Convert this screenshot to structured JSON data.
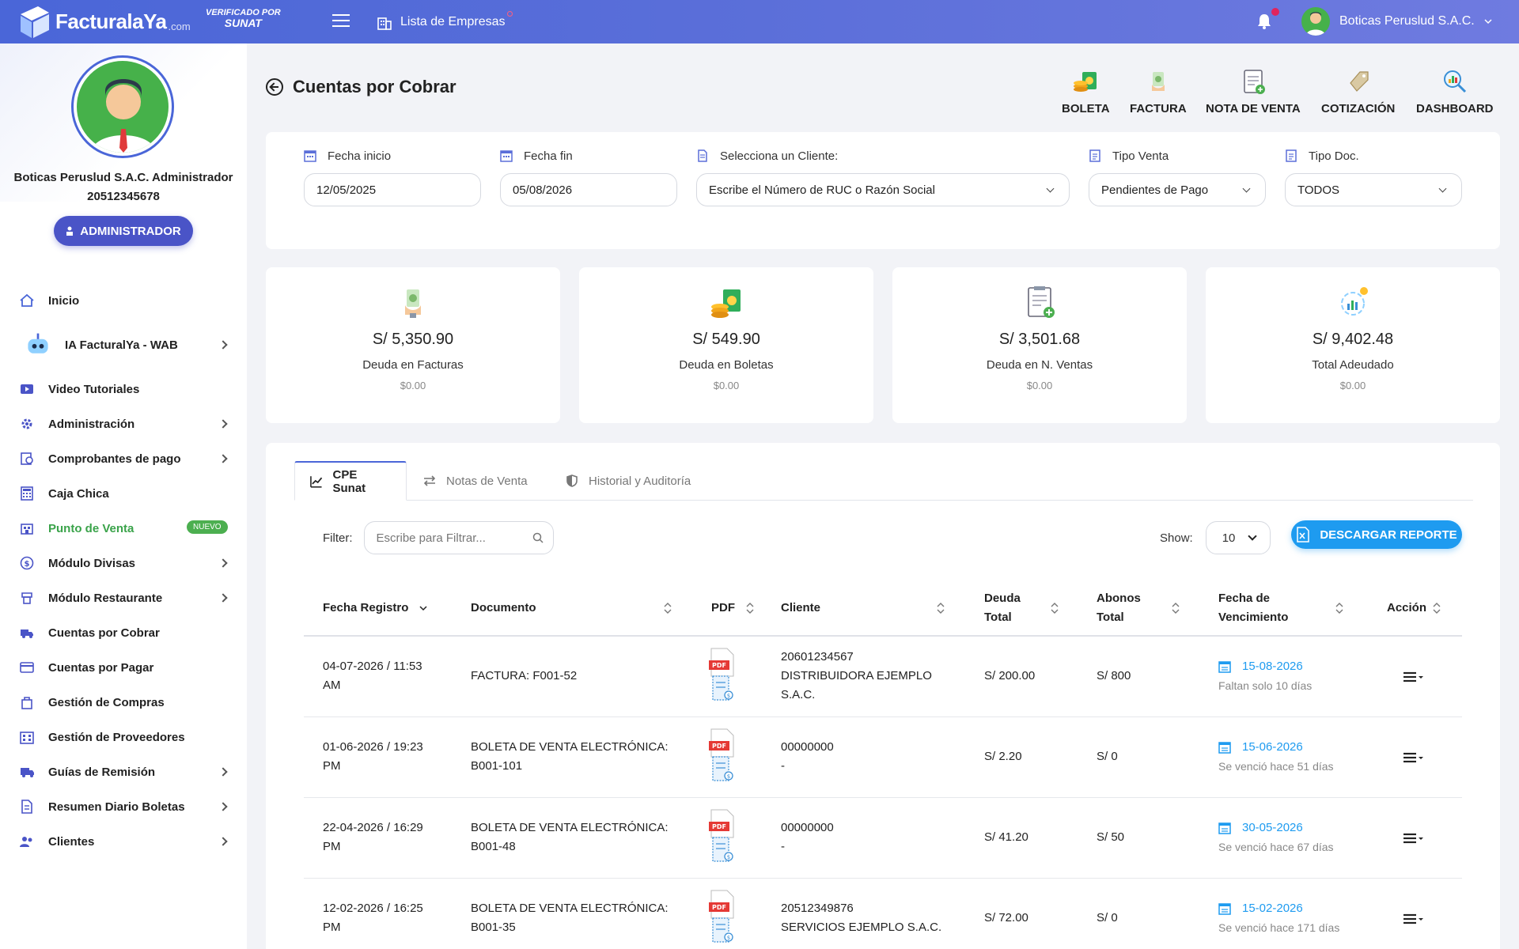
{
  "topbar": {
    "brand": "FacturalaYa",
    "brand_suffix": ".com",
    "verified_line1": "VERIFICADO",
    "verified_line1b": "POR",
    "verified_line2": "SUNAT",
    "empresas_label": "Lista de Empresas",
    "user_name": "Boticas Peruslud S.A.C."
  },
  "sidebar": {
    "profile_name": "Boticas Peruslud S.A.C. Administrador",
    "profile_ruc": "20512345678",
    "role_button": "ADMINISTRADOR",
    "items": [
      {
        "label": "Inicio",
        "icon": "home-icon",
        "chevron": false
      },
      {
        "label": "IA FacturalYa - WAB",
        "icon": "robot-icon",
        "chevron": true
      },
      {
        "label": "Video Tutoriales",
        "icon": "video-icon",
        "chevron": false
      },
      {
        "label": "Administración",
        "icon": "gear-icon",
        "chevron": true
      },
      {
        "label": "Comprobantes de pago",
        "icon": "receipt-icon",
        "chevron": true
      },
      {
        "label": "Caja Chica",
        "icon": "calculator-icon",
        "chevron": false
      },
      {
        "label": "Punto de Venta",
        "icon": "store-icon",
        "chevron": false,
        "badge": "NUEVO"
      },
      {
        "label": "Módulo Divisas",
        "icon": "currency-icon",
        "chevron": true
      },
      {
        "label": "Módulo Restaurante",
        "icon": "restaurant-icon",
        "chevron": true
      },
      {
        "label": "Cuentas por Cobrar",
        "icon": "truck-icon",
        "chevron": false
      },
      {
        "label": "Cuentas por Pagar",
        "icon": "card-icon",
        "chevron": false
      },
      {
        "label": "Gestión de Compras",
        "icon": "bag-icon",
        "chevron": false
      },
      {
        "label": "Gestión de Proveedores",
        "icon": "building-icon",
        "chevron": false
      },
      {
        "label": "Guías de Remisión",
        "icon": "delivery-icon",
        "chevron": true
      },
      {
        "label": "Resumen Diario Boletas",
        "icon": "document-icon",
        "chevron": true
      },
      {
        "label": "Clientes",
        "icon": "users-icon",
        "chevron": true
      }
    ]
  },
  "page": {
    "title": "Cuentas por Cobrar",
    "quick_actions": [
      "BOLETA",
      "FACTURA",
      "NOTA DE VENTA",
      "COTIZACIÓN",
      "DASHBOARD"
    ]
  },
  "filters": {
    "fecha_inicio_label": "Fecha inicio",
    "fecha_inicio_value": "12/05/2025",
    "fecha_fin_label": "Fecha fin",
    "fecha_fin_value": "05/08/2026",
    "cliente_label": "Selecciona un Cliente:",
    "cliente_value": "Escribe el Número de RUC o Razón Social",
    "tipo_venta_label": "Tipo Venta",
    "tipo_venta_value": "Pendientes de Pago",
    "tipo_doc_label": "Tipo Doc.",
    "tipo_doc_value": "TODOS"
  },
  "stats": [
    {
      "amount": "S/ 5,350.90",
      "label": "Deuda en Facturas",
      "sub": "$0.00"
    },
    {
      "amount": "S/ 549.90",
      "label": "Deuda en Boletas",
      "sub": "$0.00"
    },
    {
      "amount": "S/ 3,501.68",
      "label": "Deuda en N. Ventas",
      "sub": "$0.00"
    },
    {
      "amount": "S/ 9,402.48",
      "label": "Total Adeudado",
      "sub": "$0.00"
    }
  ],
  "tabs": [
    "CPE Sunat",
    "Notas de Venta",
    "Historial y Auditoría"
  ],
  "toolbar": {
    "filter_label": "Filter:",
    "filter_placeholder": "Escribe para Filtrar...",
    "show_label": "Show:",
    "show_value": "10",
    "download_label": "DESCARGAR REPORTE"
  },
  "table": {
    "headers": {
      "fecha": "Fecha Registro",
      "documento": "Documento",
      "pdf": "PDF",
      "cliente": "Cliente",
      "deuda_1": "Deuda",
      "deuda_2": "Total",
      "abonos_1": "Abonos",
      "abonos_2": "Total",
      "venc_1": "Fecha de",
      "venc_2": "Vencimiento",
      "accion": "Acción"
    },
    "rows": [
      {
        "fecha_1": "04-07-2026 / 11:53",
        "fecha_2": "AM",
        "doc_1": "FACTURA: F001-52",
        "doc_2": "",
        "cliente_1": "20601234567",
        "cliente_2": "DISTRIBUIDORA EJEMPLO",
        "cliente_3": "S.A.C.",
        "deuda": "S/ 200.00",
        "abonos": "S/ 800",
        "venc": "15-08-2026",
        "nota": "Faltan solo 10 días"
      },
      {
        "fecha_1": "01-06-2026 / 19:23",
        "fecha_2": "PM",
        "doc_1": "BOLETA DE VENTA ELECTRÓNICA:",
        "doc_2": "B001-101",
        "cliente_1": "00000000",
        "cliente_2": "-",
        "cliente_3": "",
        "deuda": "S/ 2.20",
        "abonos": "S/ 0",
        "venc": "15-06-2026",
        "nota": "Se venció hace 51 días"
      },
      {
        "fecha_1": "22-04-2026 / 16:29",
        "fecha_2": "PM",
        "doc_1": "BOLETA DE VENTA ELECTRÓNICA:",
        "doc_2": "B001-48",
        "cliente_1": "00000000",
        "cliente_2": "-",
        "cliente_3": "",
        "deuda": "S/ 41.20",
        "abonos": "S/ 50",
        "venc": "30-05-2026",
        "nota": "Se venció hace 67 días"
      },
      {
        "fecha_1": "12-02-2026 / 16:25",
        "fecha_2": "PM",
        "doc_1": "BOLETA DE VENTA ELECTRÓNICA:",
        "doc_2": "B001-35",
        "cliente_1": "20512349876",
        "cliente_2": "SERVICIOS EJEMPLO S.A.C.",
        "cliente_3": "",
        "deuda": "S/ 72.00",
        "abonos": "S/ 0",
        "venc": "15-02-2026",
        "nota": "Se venció hace 171 días"
      }
    ]
  },
  "colors": {
    "primary": "#4a66d8",
    "accent": "#1e9bf0",
    "success": "#4caf50"
  }
}
